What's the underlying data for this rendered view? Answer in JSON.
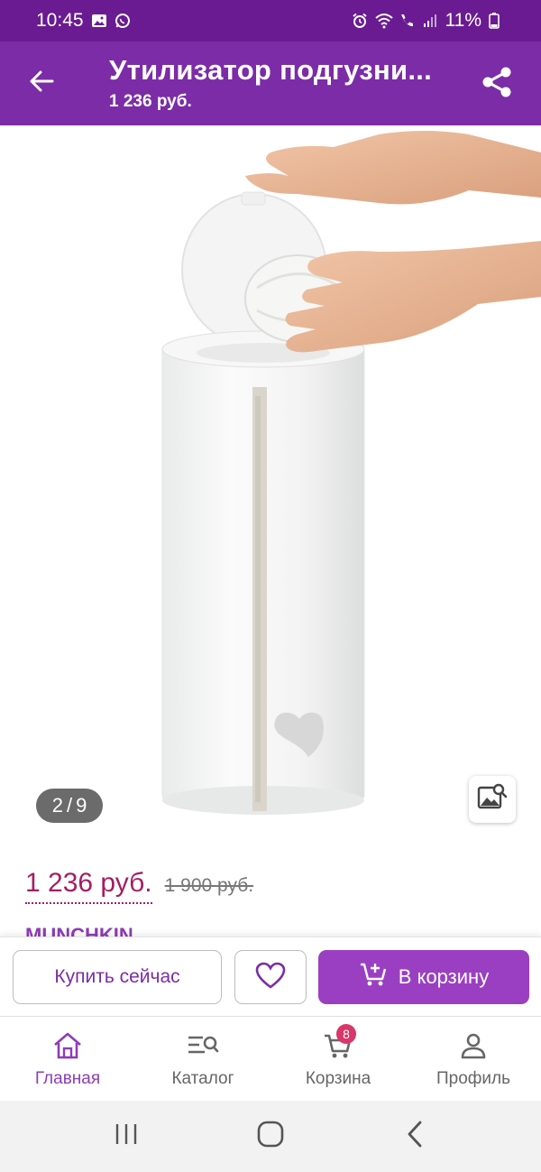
{
  "status_bar": {
    "time": "10:45",
    "battery": "11%",
    "left_icons": [
      "gallery-icon",
      "whatsapp-icon"
    ],
    "right_icons": [
      "alarm-icon",
      "wifi-icon",
      "call-icon",
      "signal-icon",
      "battery-icon"
    ]
  },
  "header": {
    "title": "Утилизатор подгузни...",
    "subtitle": "1 236 руб.",
    "back_icon": "arrow-left-icon",
    "share_icon": "share-icon",
    "color": "#7b2ca6",
    "status_color": "#6a1b91"
  },
  "gallery": {
    "counter_current": "2",
    "counter_separator": "/",
    "counter_total": "9",
    "image_search_icon": "image-search-icon"
  },
  "price": {
    "current": "1 236 руб.",
    "old": "1 900 руб.",
    "accent": "#a31e63"
  },
  "brand": {
    "name": "MUNCHKIN"
  },
  "actions": {
    "buy_now_label": "Купить сейчас",
    "add_to_cart_label": "В корзину",
    "cart_button_color": "#9b3fc2"
  },
  "bottom_nav": {
    "items": [
      {
        "label": "Главная",
        "icon": "home-icon",
        "active": true
      },
      {
        "label": "Каталог",
        "icon": "catalog-search-icon",
        "active": false
      },
      {
        "label": "Корзина",
        "icon": "cart-icon",
        "active": false,
        "badge": "8"
      },
      {
        "label": "Профиль",
        "icon": "profile-icon",
        "active": false
      }
    ]
  }
}
